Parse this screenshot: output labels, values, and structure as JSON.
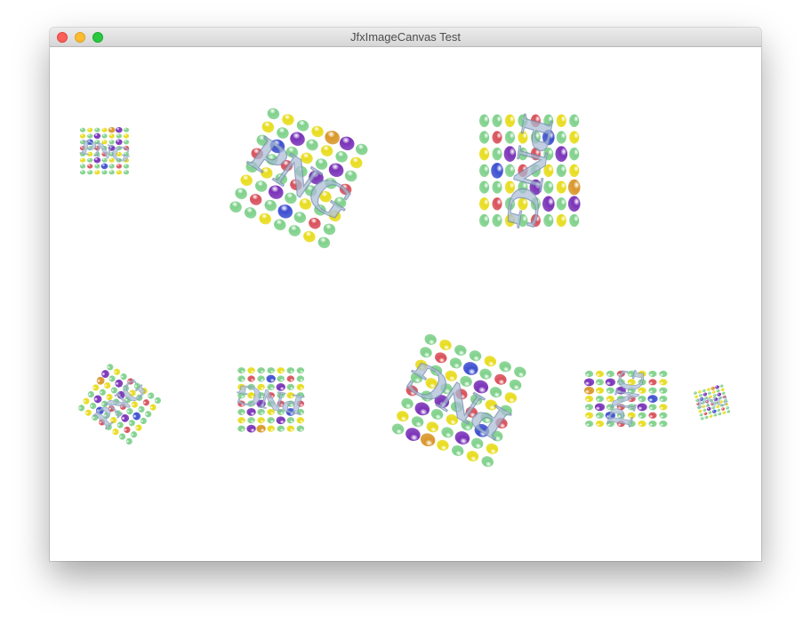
{
  "window": {
    "title": "JfxImageCanvas Test"
  },
  "canvas": {
    "image_text": "PNG",
    "ball_colors": {
      "green": "#7fd18b",
      "yellow": "#e8dc1c",
      "red": "#d9505a",
      "purple": "#7a32b8",
      "blue": "#3d4fd0",
      "orange": "#d9962a"
    },
    "text_color": "#a9bcd6",
    "background_color": "#ffffff"
  }
}
